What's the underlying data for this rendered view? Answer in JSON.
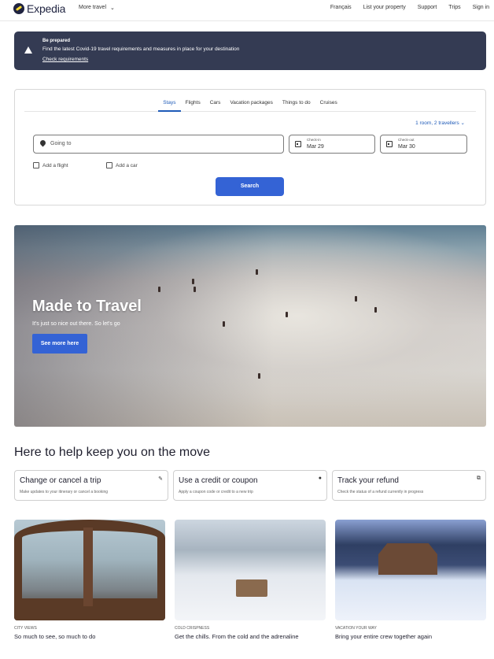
{
  "header": {
    "brand": "Expedia",
    "more_travel": "More travel",
    "links": [
      "Français",
      "List your property",
      "Support",
      "Trips",
      "Sign in"
    ]
  },
  "alert": {
    "title": "Be prepared",
    "message": "Find the latest Covid-19 travel requirements and measures in place for your destination",
    "link": "Check requirements"
  },
  "search": {
    "tabs": [
      {
        "label": "Stays",
        "active": true
      },
      {
        "label": "Flights",
        "active": false
      },
      {
        "label": "Cars",
        "active": false
      },
      {
        "label": "Vacation packages",
        "active": false
      },
      {
        "label": "Things to do",
        "active": false
      },
      {
        "label": "Cruises",
        "active": false
      }
    ],
    "travellers": "1 room, 2 travellers",
    "going_to_placeholder": "Going to",
    "checkin_label": "Check-in",
    "checkin_value": "Mar 29",
    "checkout_label": "Check-out",
    "checkout_value": "Mar 30",
    "add_flight": "Add a flight",
    "add_car": "Add a car",
    "button": "Search"
  },
  "hero": {
    "title": "Made to Travel",
    "subtitle": "It's just so nice out there. So let's go",
    "button": "See more here"
  },
  "help": {
    "heading": "Here to help keep you on the move",
    "cards": [
      {
        "title": "Change or cancel a trip",
        "desc": "Make updates to your itinerary or cancel a booking",
        "icon": "pencil-icon"
      },
      {
        "title": "Use a credit or coupon",
        "desc": "Apply a coupon code or credit to a new trip",
        "icon": "coupon-icon"
      },
      {
        "title": "Track your refund",
        "desc": "Check the status of a refund currently in progress",
        "icon": "refund-icon"
      }
    ]
  },
  "promos": [
    {
      "kicker": "City views",
      "title": "So much to see, so much to do"
    },
    {
      "kicker": "Cold crispness",
      "title": "Get the chills. From the cold and the adrenaline"
    },
    {
      "kicker": "Vacation your way",
      "title": "Bring your entire crew together again"
    }
  ],
  "colors": {
    "accent": "#3463d5",
    "alert_bg": "#343b53",
    "brand_navy": "#1f2340",
    "link_blue": "#1f5bb8"
  }
}
